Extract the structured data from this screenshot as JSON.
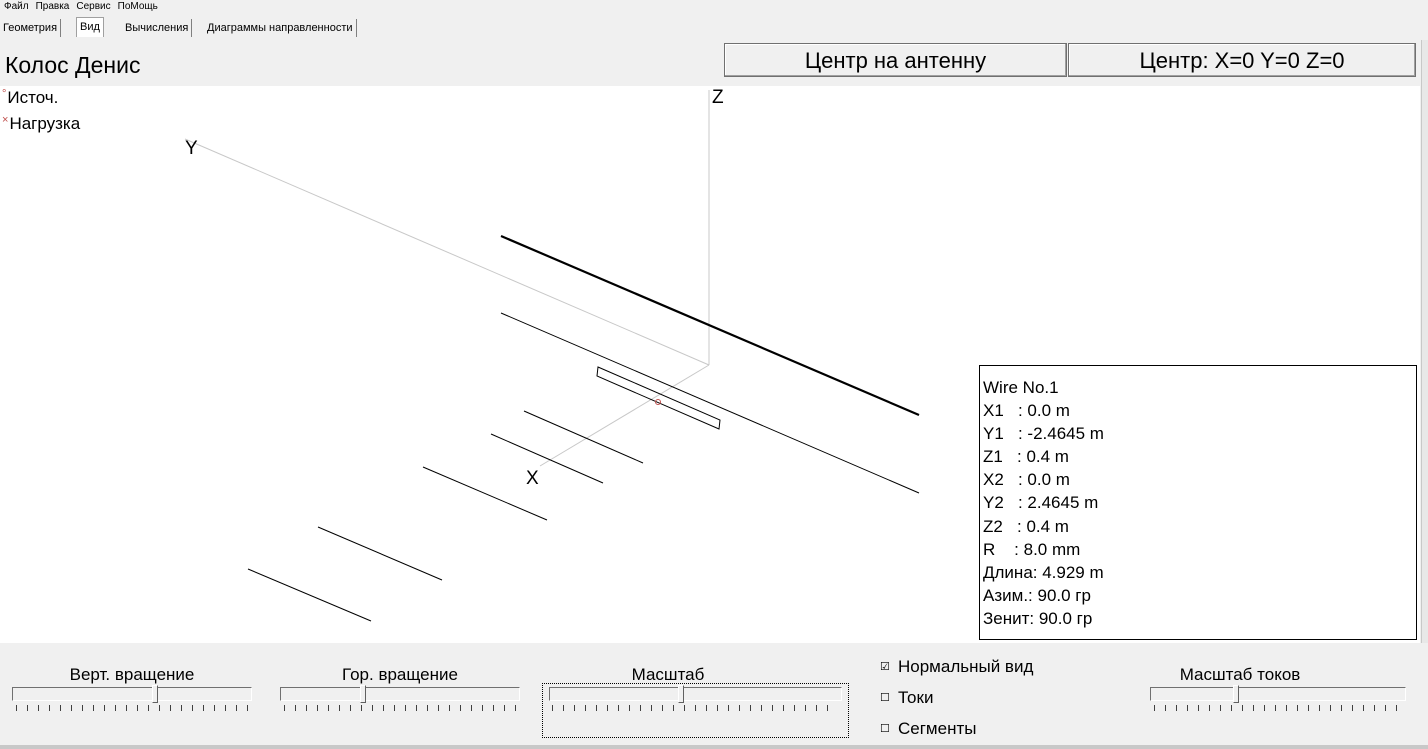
{
  "menu": {
    "items": [
      "Файл",
      "Правка",
      "Сервис",
      "ПоМощь"
    ]
  },
  "tabs": [
    {
      "label": "Геометрия"
    },
    {
      "label": "Вид"
    },
    {
      "label": "Вычисления"
    },
    {
      "label": "Диаграммы направленности"
    }
  ],
  "active_tab": "Вид",
  "project_title": "Колос Денис",
  "buttons": {
    "center_antenna": "Центр на антенну",
    "center_origin": "Центр: X=0 Y=0 Z=0"
  },
  "legend": {
    "source_marker": "°",
    "source_label": "Источ.",
    "load_marker": "×",
    "load_label": "Нагрузка"
  },
  "axes": {
    "x": "X",
    "y": "Y",
    "z": "Z"
  },
  "wire_info": [
    "Wire No.1",
    "X1   : 0.0 m",
    "Y1   : -2.4645 m",
    "Z1   : 0.4 m",
    "X2   : 0.0 m",
    "Y2   : 2.4645 m",
    "Z2   : 0.4 m",
    "R    : 8.0 mm",
    "Длина: 4.929 m",
    "Азим.: 90.0 гр",
    "Зенит: 90.0 гр"
  ],
  "controls": {
    "vert_rotation": "Верт. вращение",
    "hor_rotation": "Гор. вращение",
    "scale": "Масштаб",
    "current_scale": "Масштаб токов",
    "vert_rotation_value": 0.6,
    "hor_rotation_value": 0.34,
    "scale_value": 0.45,
    "current_scale_value": 0.33
  },
  "checkboxes": [
    {
      "label": "Нормальный вид",
      "checked": true,
      "mark": "☑"
    },
    {
      "label": "Токи",
      "checked": false,
      "mark": "☐"
    },
    {
      "label": "Сегменты",
      "checked": false,
      "mark": "☐"
    }
  ]
}
